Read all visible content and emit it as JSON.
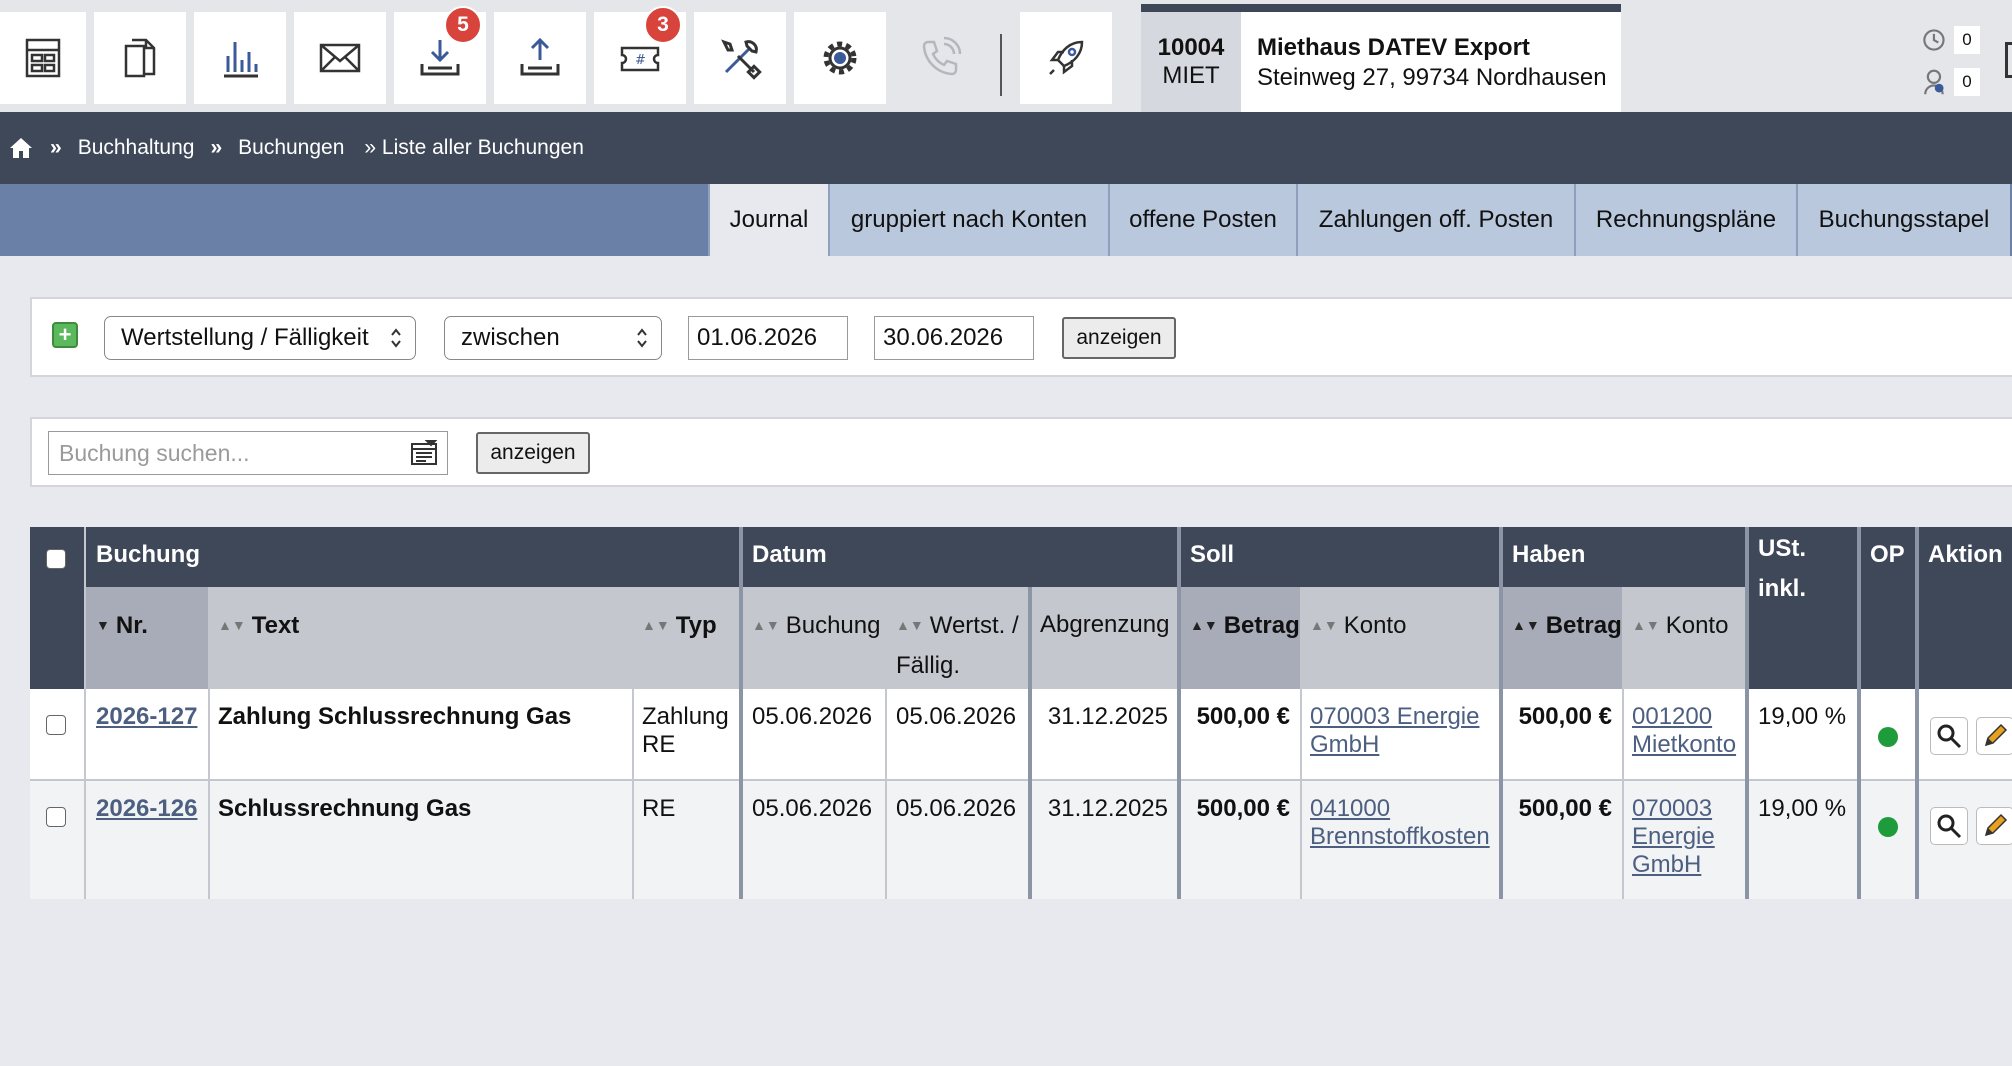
{
  "toolbar": {
    "buttons": [
      {
        "icon": "dashboard-icon"
      },
      {
        "icon": "documents-icon"
      },
      {
        "icon": "bar-chart-icon"
      },
      {
        "icon": "mail-icon"
      },
      {
        "icon": "download-tray-icon",
        "badge": "5"
      },
      {
        "icon": "upload-tray-icon"
      },
      {
        "icon": "ticket-icon",
        "badge": "3"
      },
      {
        "icon": "tools-icon"
      },
      {
        "icon": "settings-gear-icon"
      },
      {
        "icon": "phone-icon"
      },
      {
        "icon": "rocket-icon"
      }
    ],
    "badge_color": "#d8433b"
  },
  "company": {
    "number": "10004",
    "code": "MIET",
    "name": "Miethaus DATEV Export",
    "address": "Steinweg 27, 99734 Nordhausen"
  },
  "counters": [
    {
      "icon": "clock-icon",
      "value": "0"
    },
    {
      "icon": "user-clock-icon",
      "value": "0"
    }
  ],
  "breadcrumb": {
    "home_icon": "home-icon",
    "items": [
      "Buchhaltung",
      "Buchungen",
      "» Liste aller Buchungen"
    ],
    "separator": "»"
  },
  "tabs": [
    {
      "label": "Journal",
      "active": true
    },
    {
      "label": "gruppiert nach Konten"
    },
    {
      "label": "offene Posten"
    },
    {
      "label": "Zahlungen off. Posten"
    },
    {
      "label": "Rechnungspläne"
    },
    {
      "label": "Buchungsstapel"
    }
  ],
  "filter": {
    "field": "Wertstellung / Fälligkeit",
    "operator": "zwischen",
    "from": "01.06.2026",
    "to": "30.06.2026",
    "button": "anzeigen"
  },
  "search": {
    "placeholder": "Buchung suchen...",
    "button": "anzeigen"
  },
  "table": {
    "groups": {
      "buchung": "Buchung",
      "datum": "Datum",
      "soll": "Soll",
      "haben": "Haben",
      "ust": "USt. inkl.",
      "op": "OP",
      "aktion": "Aktion"
    },
    "columns": {
      "nr": "Nr.",
      "text": "Text",
      "typ": "Typ",
      "buchung": "Buchung",
      "wertst": "Wertst. / Fällig.",
      "abgrenzung": "Abgrenzung",
      "soll_betrag": "Betrag",
      "soll_konto": "Konto",
      "haben_betrag": "Betrag",
      "haben_konto": "Konto"
    },
    "rows": [
      {
        "nr": "2026-127",
        "text": "Zahlung Schlussrechnung Gas",
        "typ": "Zahlung RE",
        "buchung": "05.06.2026",
        "wertst": "05.06.2026",
        "abgrenzung": "31.12.2025",
        "soll_betrag": "500,00 €",
        "soll_konto": "070003 Energie GmbH",
        "haben_betrag": "500,00 €",
        "haben_konto": "001200 Mietkonto",
        "ust": "19,00 %",
        "op_status": "green"
      },
      {
        "nr": "2026-126",
        "text": "Schlussrechnung Gas",
        "typ": "RE",
        "buchung": "05.06.2026",
        "wertst": "05.06.2026",
        "abgrenzung": "31.12.2025",
        "soll_betrag": "500,00 €",
        "soll_konto": "041000 Brennstoffkosten",
        "haben_betrag": "500,00 €",
        "haben_konto": "070003 Energie GmbH",
        "ust": "19,00 %",
        "op_status": "green"
      }
    ],
    "actions": [
      {
        "icon": "magnifier-icon"
      },
      {
        "icon": "pencil-icon"
      }
    ]
  }
}
